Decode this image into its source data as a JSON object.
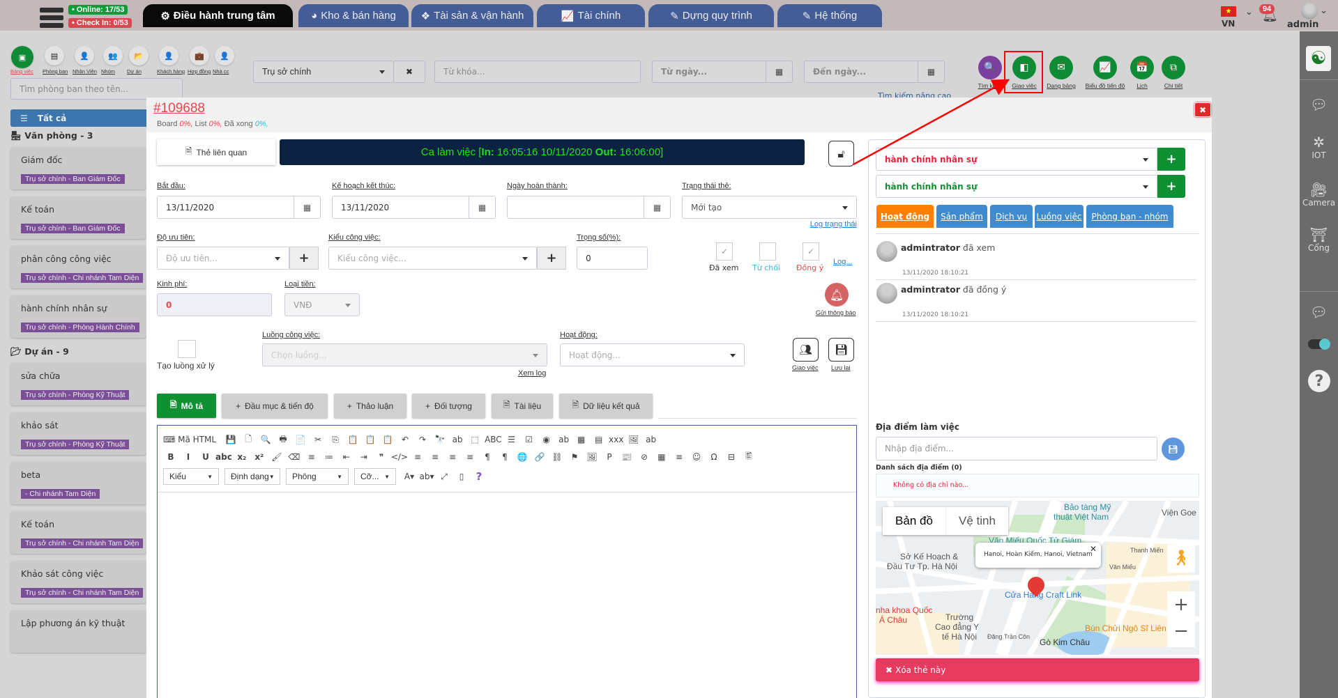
{
  "topbar": {
    "online": "• Online: 17/53",
    "checkin": "• Check In: 0/53",
    "tabs": [
      {
        "label": "Điều hành trung tâm",
        "icon": "gear-icon",
        "glyph": "⚙"
      },
      {
        "label": "Kho & bán hàng",
        "icon": "pie-chart-icon",
        "glyph": "◕"
      },
      {
        "label": "Tài sản & vận hành",
        "icon": "cubes-icon",
        "glyph": "❖"
      },
      {
        "label": "Tài chính",
        "icon": "line-chart-icon",
        "glyph": "📈"
      },
      {
        "label": "Dựng quy trình",
        "icon": "edit-icon",
        "glyph": "✎"
      },
      {
        "label": "Hệ thống",
        "icon": "edit-icon",
        "glyph": "✎"
      }
    ],
    "lang": "VN",
    "notifications": "94",
    "user": "admin"
  },
  "leftnav": {
    "items": [
      {
        "label": "Bảng việc",
        "glyph": "▣"
      },
      {
        "label": "Phòng ban",
        "glyph": "▤"
      },
      {
        "label": "Nhân Viên",
        "glyph": "👤"
      },
      {
        "label": "Nhóm",
        "glyph": "👥"
      },
      {
        "label": "Dự án",
        "glyph": "📂"
      },
      {
        "label": "Khách hàng",
        "glyph": "👤"
      },
      {
        "label": "Hợp đồng",
        "glyph": "💼"
      },
      {
        "label": "Nhà cc",
        "glyph": "👤"
      }
    ],
    "search_placeholder": "Tìm phòng ban theo tên...",
    "all": "Tất cả",
    "groups": [
      {
        "title": "Văn phòng - 3",
        "items": [
          {
            "name": "Giám đốc",
            "tag": "Trụ sở chính - Ban Giám Đốc"
          },
          {
            "name": "Kế toán",
            "tag": "Trụ sở chính - Ban Giám Đốc"
          },
          {
            "name": "phân công công việc",
            "tag": "Trụ sở chính - Chi nhánh Tam Diện"
          },
          {
            "name": "hành chính nhân sự",
            "tag": "Trụ sở chính - Phòng Hành Chính"
          }
        ]
      },
      {
        "title": "Dự án - 9",
        "items": [
          {
            "name": "sửa chữa",
            "tag": "Trụ sở chính - Phòng Kỹ Thuật"
          },
          {
            "name": "khảo sát",
            "tag": "Trụ sở chính - Phòng Kỹ Thuật"
          },
          {
            "name": "beta",
            "tag": " - Chi nhánh Tam Diện"
          },
          {
            "name": "Kế toán",
            "tag": "Trụ sở chính - Chi nhánh Tam Diện"
          },
          {
            "name": "Khảo sát công việc",
            "tag": "Trụ sở chính - Chi nhánh Tam Diện"
          },
          {
            "name": "Lập phương án kỹ thuật",
            "tag": ""
          }
        ]
      }
    ]
  },
  "filters": {
    "branch": "Trụ sở chính",
    "keyword_placeholder": "Từ khóa...",
    "from_placeholder": "Từ ngày...",
    "to_placeholder": "Đến ngày...",
    "advanced": "Tìm kiếm nâng cao"
  },
  "views": [
    {
      "label": "Tìm kiếm",
      "glyph": "🔍",
      "color": "#7b3f9e"
    },
    {
      "label": "Giao việc",
      "glyph": "◧",
      "color": "#0f8a35"
    },
    {
      "label": "Dạng bảng",
      "glyph": "✉",
      "color": "#0f8a35"
    },
    {
      "label": "Biểu đồ tiến độ",
      "glyph": "📈",
      "color": "#0f8a35"
    },
    {
      "label": "Lịch",
      "glyph": "📅",
      "color": "#0f8a35"
    },
    {
      "label": "Chi tiết",
      "glyph": "⧉",
      "color": "#0f8a35"
    }
  ],
  "card": {
    "id": "#109688",
    "progress": {
      "board_label": "Board",
      "board": "0%,",
      "list_label": "List",
      "list": "0%,",
      "done_label": "Đã xong",
      "done": "0%,"
    },
    "related": "Thẻ liên quan",
    "shift": {
      "prefix": "Ca làm việc [",
      "in_label": "In:",
      "in": " 16:05:16 10/11/2020 ",
      "out_label": "Out:",
      "out": " 16:06:00]"
    },
    "start_label": "Bắt đầu:",
    "start": "13/11/2020",
    "plan_end_label": "Kế hoạch kết thúc:",
    "plan_end": "13/11/2020",
    "done_date_label": "Ngày hoàn thành:",
    "done_date": "",
    "status_label": "Trạng thái thẻ:",
    "status": "Mới tạo",
    "status_log": "Log trạng thái",
    "priority_label": "Độ ưu tiên:",
    "priority_placeholder": "Độ ưu tiên...",
    "type_label": "Kiểu công việc:",
    "type_placeholder": "Kiểu công việc...",
    "weight_label": "Trọng số(%):",
    "weight": "0",
    "seen": "Đã xem",
    "rejected": "Từ chối",
    "agreed": "Đồng ý",
    "log": "Log...",
    "cost_label": "Kinh phí:",
    "cost": "0",
    "currency_label": "Loại tiền:",
    "currency": "VNĐ",
    "notify": "Gửi thông báo",
    "create_flow": "Tạo luồng xử lý",
    "flow_label": "Luồng công việc:",
    "flow_placeholder": "Chọn luồng...",
    "view_log": "Xem log",
    "activity_label": "Hoạt động:",
    "activity_placeholder": "Hoạt động...",
    "assign": "Giao việc",
    "save": "Lưu lại",
    "tabs": [
      "Mô tả",
      "Đầu mục & tiến độ",
      "Thảo luận",
      "Đối tượng",
      "Tài liệu",
      "Dữ liệu kết quả"
    ],
    "editor": {
      "html_label": "Mã HTML",
      "row1": [
        "💾",
        "🗋",
        "🔍",
        "🖶",
        "📄",
        "✂",
        "⎘",
        "📋",
        "📋",
        "📋",
        "↶",
        "↷",
        "🔭",
        "ab",
        "⬚",
        "ABC",
        "☰",
        "☑",
        "◉",
        "ab",
        "▦",
        "▤",
        "xxx",
        "🖼",
        "ab"
      ],
      "row2": [
        "B",
        "I",
        "U",
        "abc",
        "x₂",
        "x²",
        "🖌",
        "⌫",
        "≡",
        "≔",
        "⇤",
        "⇥",
        "❞",
        "</>",
        "≡",
        "≡",
        "≡",
        "≡",
        "¶",
        "¶",
        "🌐",
        "🔗",
        "⛓",
        "⚑",
        "🖼",
        "P",
        "📰",
        "⊘",
        "▦",
        "≡",
        "☺",
        "Ω",
        "⊟",
        "🖺"
      ],
      "selects": [
        "Kiểu",
        "Định dạng",
        "Phông",
        "Cỡ..."
      ]
    }
  },
  "side": {
    "select1": "hành chính nhân sự",
    "select2": "hành chính nhân sự",
    "tabs": [
      "Hoạt động",
      "Sản phẩm",
      "Dịch vụ",
      "Luồng việc",
      "Phòng ban - nhóm"
    ],
    "activities": [
      {
        "user": "admintrator",
        "action": "đã xem",
        "time": "13/11/2020 18:10:21"
      },
      {
        "user": "admintrator",
        "action": "đã đồng ý",
        "time": "13/11/2020 18:10:21"
      }
    ],
    "location_label": "Địa điểm làm việc",
    "location_placeholder": "Nhập địa điểm...",
    "list_label": "Danh sách địa điểm (0)",
    "empty": "Không có địa chỉ nào...",
    "map": {
      "tab_map": "Bản đồ",
      "tab_sat": "Vệ tinh",
      "popup": "Hanoi, Hoàn Kiếm, Hanoi, Vietnam",
      "labels": [
        "Bảo tàng Mỹ",
        "thuật Việt Nam",
        "Viện Goe",
        "Văn Miếu Quốc Tử Giám",
        "Sở Kế Hoạch &",
        "Đầu Tư Tp. Hà Nội",
        "Cửa Hàng Craft Link",
        "Thanh Miến",
        "Văn Miếu",
        "nha khoa Quốc",
        "Á Châu",
        "Trường",
        "Cao đẳng Y",
        "tế Hà Nội",
        "Đặng Trần Côn",
        "Bún Chửi Ngô Sĩ Liên",
        "Gò Kim Châu"
      ]
    },
    "delete": "Xóa thẻ này"
  },
  "rightbar": {
    "iot": "IOT",
    "camera": "Camera",
    "gate": "Cổng"
  }
}
